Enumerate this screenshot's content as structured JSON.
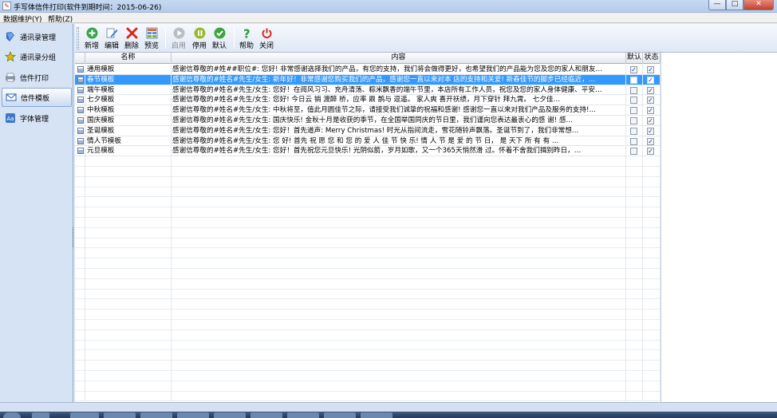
{
  "window": {
    "title": "手写体信件打印(软件到期时间：2015-06-26)",
    "app_icon": "pen-icon",
    "buttons": [
      "—",
      "□",
      "✕"
    ]
  },
  "menu": [
    {
      "label": "数据维护(Y)"
    },
    {
      "label": "帮助(Z)"
    }
  ],
  "nav": [
    {
      "label": "通讯录管理",
      "icon": "book-icon"
    },
    {
      "label": "通讯录分组",
      "icon": "star-icon"
    },
    {
      "label": "信件打印",
      "icon": "printer-icon"
    },
    {
      "label": "信件模板",
      "icon": "envelope-icon",
      "active": true
    },
    {
      "label": "字体管理",
      "icon": "font-icon"
    }
  ],
  "toolbar": {
    "new": "新增",
    "edit": "编辑",
    "delete": "删除",
    "preview": "预览",
    "enable": "启用",
    "disable": "停用",
    "default": "默认",
    "help": "帮助",
    "close": "关闭"
  },
  "grid": {
    "columns": [
      "名称",
      "内容",
      "默认",
      "状态"
    ],
    "rows": [
      {
        "name": "通用模板",
        "content": "感谢信尊敬的#姓##职位#: 您好!        非常感谢选择我们的产品，有您的支持，我们将会做得更好，也希望我们的产品能为您及您的家人和朋友…",
        "default": true,
        "status": true
      },
      {
        "name": "春节模板",
        "content": "感谢信尊敬的#姓名#先生/女生:        新年好！非常感谢您购买我们的产品，感谢您一直以来对本 店的支持和关爱! 新春佳节的脚步已经临近，…",
        "default": false,
        "status": true,
        "selected": true
      },
      {
        "name": "端午模板",
        "content": "感谢信尊敬的#姓名#先生/女生:        您好！在阅风习习、充舟清荡、粽米飘香的端午节里，本店所有工作人员，祝您及您的家人身体健康、平安…",
        "default": false,
        "status": true
      },
      {
        "name": "七夕模板",
        "content": "感谢信尊敬的#姓名#先生/女生:        您好!        今日云 销 渡醉 桥，应率 鼎 鹊与 逗遥。 家人爽 喜开祆绩，月下穿针 拜九霄。 七夕佳…",
        "default": false,
        "status": true
      },
      {
        "name": "中秋模板",
        "content": "感谢信尊敬的#姓名#先生/女生:        中秋将至，值此月圆佳节之际，请接受我们诚挚的祝福和感谢! 感谢您一直以来对我们产品及服务的支持!…",
        "default": false,
        "status": true
      },
      {
        "name": "国庆模板",
        "content": "感谢信尊敬的#姓名#先生/女生:        国庆快乐!        金秋十月是收获的季节，在全国举国同庆的节日里，我们谨向您表达最衷心的感 谢! 感…",
        "default": false,
        "status": true
      },
      {
        "name": "圣诞模板",
        "content": "感谢信尊敬的#姓名#先生/女生:        您好！首先道声: Merry Christmas!        时光从指间流走，雪花随铃声飘落。圣诞节到了，我们非常想…",
        "default": false,
        "status": true
      },
      {
        "name": "情人节模板",
        "content": "感谢信尊敬的#姓名#先生/女生:        您 好! 首先 祝 愿 您 和 您 的 爱 人 佳 节 快 乐!        情 人 节 是 爱 的 节 日， 是 天下 所 有 有 …",
        "default": false,
        "status": true
      },
      {
        "name": "元旦模板",
        "content": "感谢信尊敬的#姓名#先生/女生:        您好！首先祝您元旦快乐!        光阴似箭，岁月如歌，又一个365天悄然滑 过。怀着不舍我们揖别昨日，…",
        "default": false,
        "status": true
      }
    ],
    "empty_rows": 24
  }
}
